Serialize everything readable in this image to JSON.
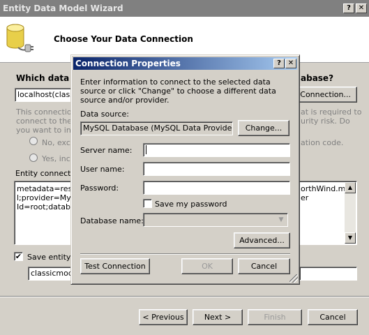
{
  "wizard": {
    "title": "Entity Data Model Wizard",
    "help_btn": "?",
    "close_btn": "✕",
    "header_title": "Choose Your Data Connection",
    "question": "Which data co",
    "question_tail": "abase?",
    "connection_value": "localhost(classic",
    "new_connection_btn": "Connection...",
    "desc_lines": [
      "This connection",
      "connect to the d",
      "you want to incl"
    ],
    "desc_right_lines": [
      "at is required to",
      "urity risk. Do"
    ],
    "radio_no": "No, excl",
    "radio_no_tail": "ation code.",
    "radio_yes": "Yes, incl",
    "entity_conn_label": "Entity connection",
    "entity_conn_lines": [
      "metadata=res:",
      "l;provider=MyS",
      "Id=root;databa"
    ],
    "entity_conn_right_lines": [
      "orthWind.ms",
      "er"
    ],
    "save_entity_label": "Save entity c",
    "save_entity_value": "classicmode",
    "buttons": {
      "previous": "< Previous",
      "next": "Next >",
      "finish": "Finish",
      "cancel": "Cancel"
    }
  },
  "dialog": {
    "title": "Connection Properties",
    "help_btn": "?",
    "close_btn": "✕",
    "intro": "Enter information to connect to the selected data source or click \"Change\" to choose a different data source and/or provider.",
    "data_source_label": "Data source:",
    "data_source_value": "MySQL Database (MySQL Data Provider)",
    "change_btn": "Change...",
    "server_name_label": "Server name:",
    "server_name_value": "",
    "user_name_label": "User name:",
    "user_name_value": "",
    "password_label": "Password:",
    "password_value": "",
    "save_password_label": "Save my password",
    "save_password_checked": false,
    "database_name_label": "Database name:",
    "database_name_value": "",
    "advanced_btn": "Advanced...",
    "test_btn": "Test Connection",
    "ok_btn": "OK",
    "cancel_btn": "Cancel"
  }
}
